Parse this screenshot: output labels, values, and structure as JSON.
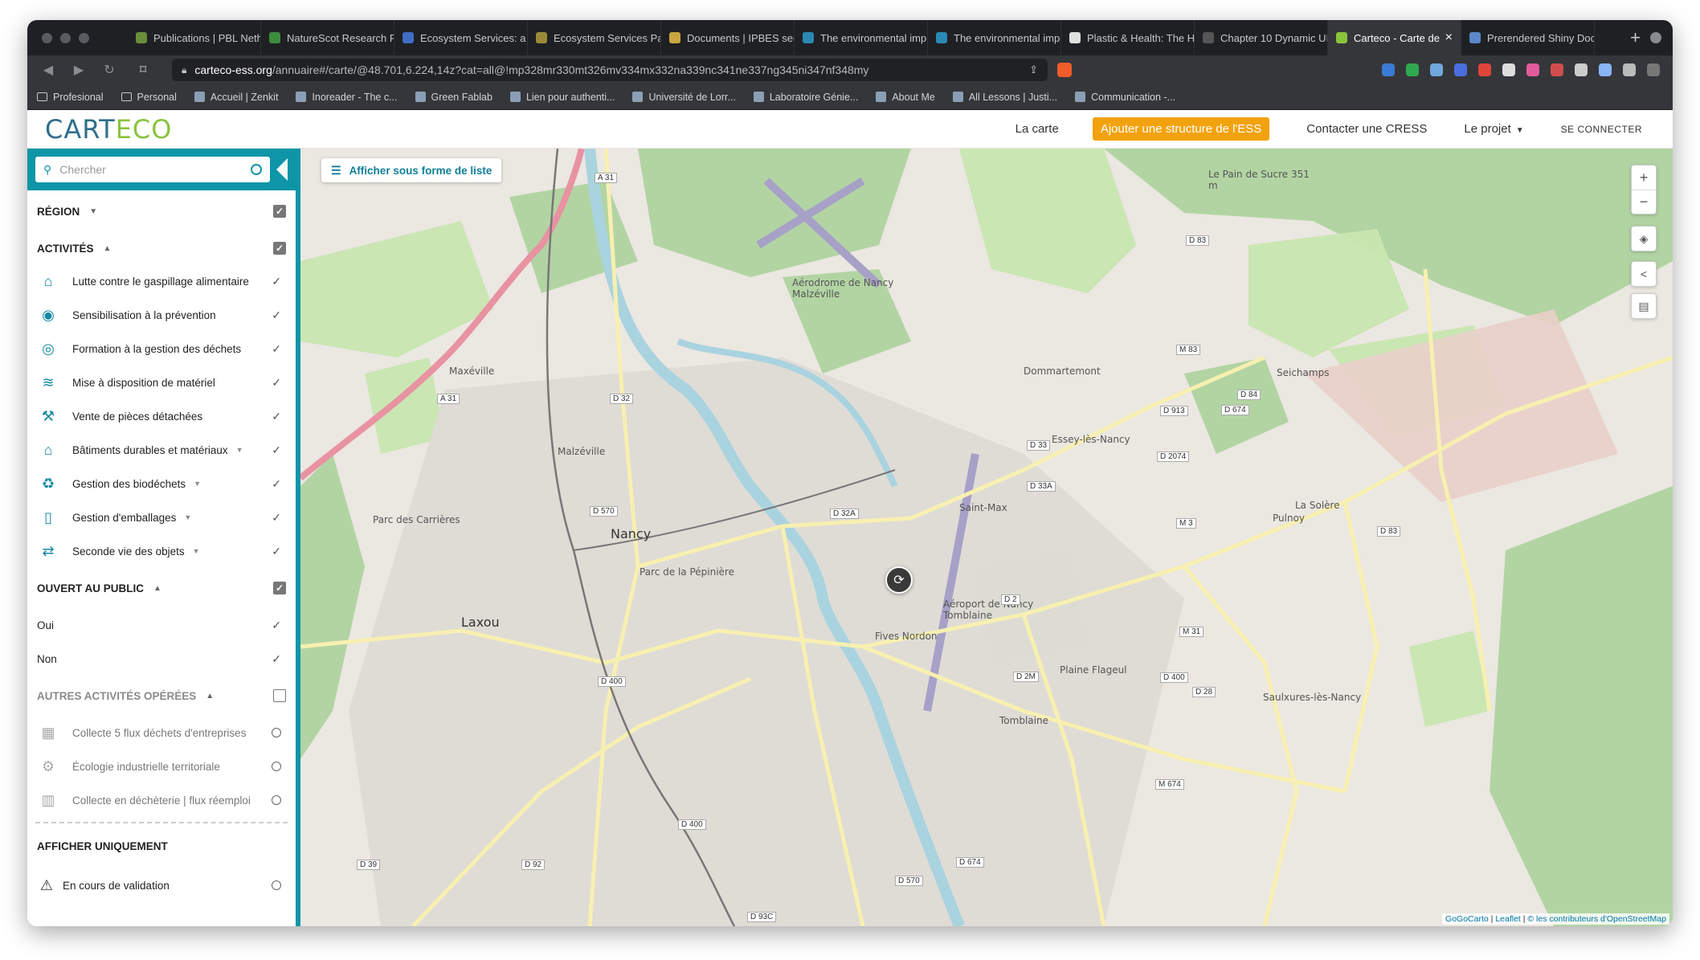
{
  "browser": {
    "tabs": [
      {
        "title": "Publications | PBL Neth",
        "fav": "#6a8d3b",
        "active": false
      },
      {
        "title": "NatureScot Research R",
        "fav": "#3c8c3c",
        "active": false
      },
      {
        "title": "Ecosystem Services: a",
        "fav": "#3f6ec4",
        "active": false
      },
      {
        "title": "Ecosystem Services Pa",
        "fav": "#9c8a3a",
        "active": false
      },
      {
        "title": "Documents | IPBES sec",
        "fav": "#c9a640",
        "active": false
      },
      {
        "title": "The environmental imp",
        "fav": "#2a8ab3",
        "active": false
      },
      {
        "title": "The environmental imp",
        "fav": "#2a8ab3",
        "active": false
      },
      {
        "title": "Plastic & Health: The H",
        "fav": "#e0e0e0",
        "active": false
      },
      {
        "title": "Chapter 10 Dynamic UI",
        "fav": "#555555",
        "active": false
      },
      {
        "title": "Carteco - Carte de",
        "fav": "#8ac33d",
        "active": true
      },
      {
        "title": "Prerendered Shiny Doc",
        "fav": "#5b87c9",
        "active": false
      }
    ],
    "url_host": "carteco-ess.org",
    "url_path": "/annuaire#/carte/@48.701,6.224,14z?cat=all@!mp328mr330mt326mv334mx332na339nc341ne337ng345ni347nf348my",
    "bookmarks": [
      "Profesional",
      "Personal",
      "Accueil | Zenkit",
      "Inoreader - The c...",
      "Green Fablab",
      "Lien pour authenti...",
      "Université de Lorr...",
      "Laboratoire Génie...",
      "About Me",
      "All Lessons | Justi...",
      "Communication -..."
    ]
  },
  "header": {
    "logo_part1": "CART",
    "logo_part2": "ECO",
    "nav_map": "La carte",
    "nav_add": "Ajouter une structure de l'ESS",
    "nav_contact": "Contacter une CRESS",
    "nav_project": "Le projet",
    "nav_login": "SE CONNECTER"
  },
  "sidebar": {
    "search_placeholder": "Chercher",
    "region_title": "RÉGION",
    "activities_title": "ACTIVITÉS",
    "activities": [
      {
        "label": "Lutte contre le gaspillage alimentaire",
        "icon": "bag-icon",
        "glyph": "⌂",
        "has_sub": false
      },
      {
        "label": "Sensibilisation à la prévention",
        "icon": "awareness-icon",
        "glyph": "◉",
        "has_sub": false
      },
      {
        "label": "Formation à la gestion des déchets",
        "icon": "training-icon",
        "glyph": "◎",
        "has_sub": false
      },
      {
        "label": "Mise à disposition de matériel",
        "icon": "equipment-icon",
        "glyph": "≋",
        "has_sub": false
      },
      {
        "label": "Vente de pièces détachées",
        "icon": "wrench-icon",
        "glyph": "⚒",
        "has_sub": false
      },
      {
        "label": "Bâtiments durables et matériaux",
        "icon": "building-icon",
        "glyph": "⌂",
        "has_sub": true
      },
      {
        "label": "Gestion des biodéchets",
        "icon": "compost-icon",
        "glyph": "♻",
        "has_sub": true
      },
      {
        "label": "Gestion d'emballages",
        "icon": "packaging-icon",
        "glyph": "▯",
        "has_sub": true
      },
      {
        "label": "Seconde vie des objets",
        "icon": "reuse-icon",
        "glyph": "⇄",
        "has_sub": true
      }
    ],
    "public_title": "OUVERT AU PUBLIC",
    "public_options": [
      "Oui",
      "Non"
    ],
    "other_title": "AUTRES ACTIVITÉS OPÉRÉES",
    "other_activities": [
      {
        "label": "Collecte 5 flux déchets d'entreprises",
        "icon": "factory-icon",
        "glyph": "▦"
      },
      {
        "label": "Écologie industrielle territoriale",
        "icon": "gears-icon",
        "glyph": "⚙"
      },
      {
        "label": "Collecte en déchèterie | flux réemploi",
        "icon": "depot-icon",
        "glyph": "▥"
      }
    ],
    "display_only_title": "AFFICHER UNIQUEMENT",
    "validation_label": "En cours de validation"
  },
  "map": {
    "list_button": "Afficher sous forme de liste",
    "zoom_in": "+",
    "zoom_out": "−",
    "attribution_1": "GoGoCarto",
    "attribution_2": "Leaflet",
    "attribution_3": "© les contributeurs d'OpenStreetMap",
    "labels": [
      {
        "t": "Nancy",
        "big": true
      },
      {
        "t": "Maxéville",
        "big": false
      },
      {
        "t": "Malzéville",
        "big": false
      },
      {
        "t": "Dommartemont",
        "big": false
      },
      {
        "t": "Essey-lès-Nancy",
        "big": false
      },
      {
        "t": "Saint-Max",
        "big": false
      },
      {
        "t": "Laxou",
        "big": true
      },
      {
        "t": "Tomblaine",
        "big": false
      },
      {
        "t": "Seichamps",
        "big": false
      },
      {
        "t": "Pulnoy",
        "big": false
      },
      {
        "t": "Saulxures-lès-Nancy",
        "big": false
      },
      {
        "t": "Fives Nordon",
        "big": false
      },
      {
        "t": "Parc des Carrières",
        "big": false
      },
      {
        "t": "Parc de la Pépinière",
        "big": false
      },
      {
        "t": "Aérodrome de Nancy Malzéville",
        "big": false
      },
      {
        "t": "Aéroport de Nancy Tomblaine",
        "big": false
      },
      {
        "t": "Plaine Flageul",
        "big": false
      },
      {
        "t": "La Solère",
        "big": false
      },
      {
        "t": "Le Pain de Sucre 351 m",
        "big": false
      }
    ],
    "shields": [
      "A 31",
      "A 31",
      "D 32",
      "D 570",
      "D 400",
      "D 400",
      "D 2",
      "D 2M",
      "D 33",
      "D 33A",
      "D 32A",
      "D 83",
      "M 83",
      "D 913",
      "D 2074",
      "D 674",
      "M 3",
      "D 84",
      "M 31",
      "D 28",
      "M 674",
      "D 83",
      "D 39",
      "D 92",
      "D 570",
      "D 674",
      "D 93C",
      "D 400"
    ],
    "colors": {
      "park": "#c8e6b0",
      "forest": "#acd19c",
      "urban": "#dedad5",
      "water": "#a9d3df",
      "road": "#f7f0b0",
      "motorway": "#e892a2"
    }
  }
}
